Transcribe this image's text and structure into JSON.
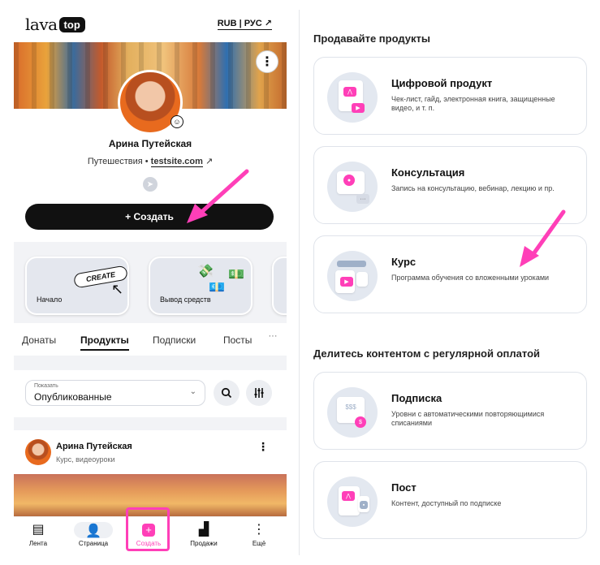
{
  "header": {
    "logo_left": "lava",
    "logo_right": "top",
    "lang": "RUB | РУС ↗"
  },
  "profile": {
    "name": "Арина Путейская",
    "subtitle_prefix": "Путешествия •",
    "website": "testsite.com",
    "website_arrow": "↗",
    "create_label": "+ Создать",
    "menu_glyph": "⋮"
  },
  "quick_cards": [
    {
      "label": "Начало",
      "pill": "CREATE"
    },
    {
      "label": "Вывод средств"
    }
  ],
  "tabs": [
    "Донаты",
    "Продукты",
    "Подписки",
    "Посты"
  ],
  "tab_more": "···",
  "filter": {
    "caption": "Показать",
    "value": "Опубликованные",
    "chevron": "⌄"
  },
  "post": {
    "author": "Арина Путейская",
    "meta": "Курс, видеоуроки",
    "dots": "⋮"
  },
  "bottom_nav": [
    {
      "label": "Лента",
      "icon": "feed-icon"
    },
    {
      "label": "Страница",
      "icon": "user-icon"
    },
    {
      "label": "Создать",
      "icon": "plus-icon"
    },
    {
      "label": "Продажи",
      "icon": "chart-icon"
    },
    {
      "label": "Ещё",
      "icon": "more-icon"
    }
  ],
  "right": {
    "section1": "Продавайте продукты",
    "section2": "Делитесь контентом с регулярной оплатой",
    "products": [
      {
        "title": "Цифровой продукт",
        "desc": "Чек-лист, гайд, электронная книга, защищенные видео, и т. п."
      },
      {
        "title": "Консультация",
        "desc": "Запись на консультацию, вебинар, лекцию и пр."
      },
      {
        "title": "Курс",
        "desc": "Программа обучения со вложенными уроками"
      }
    ],
    "recurring": [
      {
        "title": "Подписка",
        "desc": "Уровни с автоматическими повторяющимися списаниями"
      },
      {
        "title": "Пост",
        "desc": "Контент, доступный по подписке"
      }
    ]
  },
  "colors": {
    "accent": "#ff3fb8",
    "dark": "#111111",
    "card_border": "#dfe3ea"
  }
}
